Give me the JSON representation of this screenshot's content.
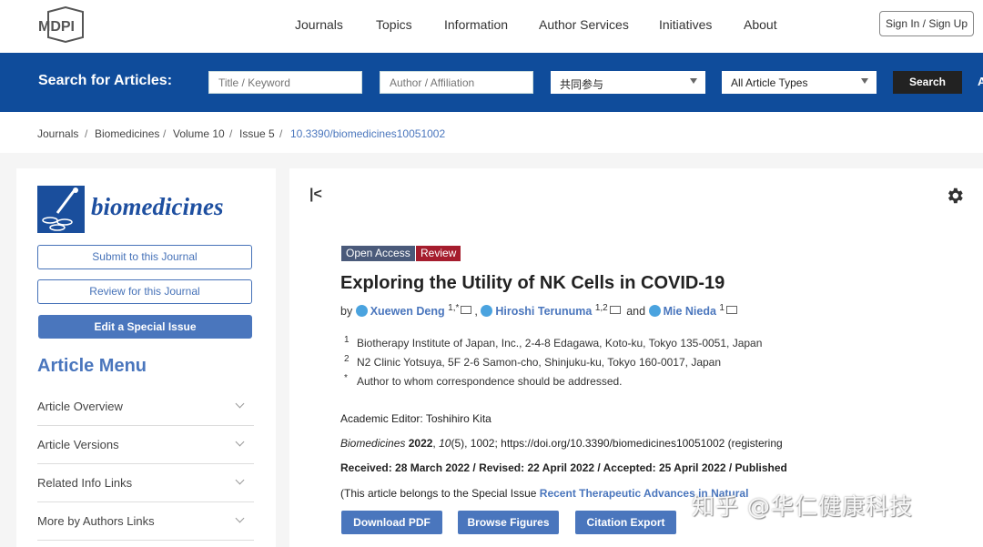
{
  "header": {
    "logo_text": "MDPI",
    "nav": [
      "Journals",
      "Topics",
      "Information",
      "Author Services",
      "Initiatives",
      "About"
    ],
    "signin": "Sign In / Sign Up"
  },
  "search": {
    "label": "Search for Articles:",
    "title_placeholder": "Title / Keyword",
    "author_placeholder": "Author / Affiliation",
    "journal_value": "共同参与",
    "type_value": "All Article Types",
    "button": "Search",
    "extra": "A"
  },
  "breadcrumb": [
    "Journals",
    "Biomedicines",
    "Volume 10",
    "Issue 5",
    "10.3390/biomedicines10051002"
  ],
  "sidebar": {
    "journal_name": "biomedicines",
    "submit": "Submit to this Journal",
    "review": "Review for this Journal",
    "edit": "Edit a Special Issue",
    "menu_title": "Article Menu",
    "menu": [
      "Article Overview",
      "Article Versions",
      "Related Info Links",
      "More by Authors Links"
    ]
  },
  "article": {
    "collapse_icon": "|<",
    "badge_open": "Open Access",
    "badge_review": "Review",
    "title": "Exploring the Utility of NK Cells in COVID-19",
    "by": "by",
    "authors": [
      {
        "name": "Xuewen Deng",
        "sup": "1,*"
      },
      {
        "name": "Hiroshi Terunuma",
        "sup": "1,2"
      },
      {
        "name": "Mie Nieda",
        "sup": "1"
      }
    ],
    "and": "and",
    "affiliations": [
      {
        "n": "1",
        "text": "Biotherapy Institute of Japan, Inc., 2-4-8 Edagawa, Koto-ku, Tokyo 135-0051, Japan"
      },
      {
        "n": "2",
        "text": "N2 Clinic Yotsuya, 5F 2-6 Samon-cho, Shinjuku-ku, Tokyo 160-0017, Japan"
      },
      {
        "n": "*",
        "text": "Author to whom correspondence should be addressed."
      }
    ],
    "editor": "Academic Editor: Toshihiro Kita",
    "citation_journal": "Biomedicines",
    "citation_year": "2022",
    "citation_vol": "10",
    "citation_rest": "(5), 1002; https://doi.org/10.3390/biomedicines10051002 (registering",
    "dates": "Received: 28 March 2022 / Revised: 22 April 2022 / Accepted: 25 April 2022 / Published",
    "special_prefix": "(This article belongs to the Special Issue",
    "special_link": "Recent Therapeutic Advances in Natural",
    "buttons": [
      "Download PDF",
      "Browse Figures",
      "Citation Export"
    ]
  },
  "watermark": "知乎 @华仁健康科技"
}
